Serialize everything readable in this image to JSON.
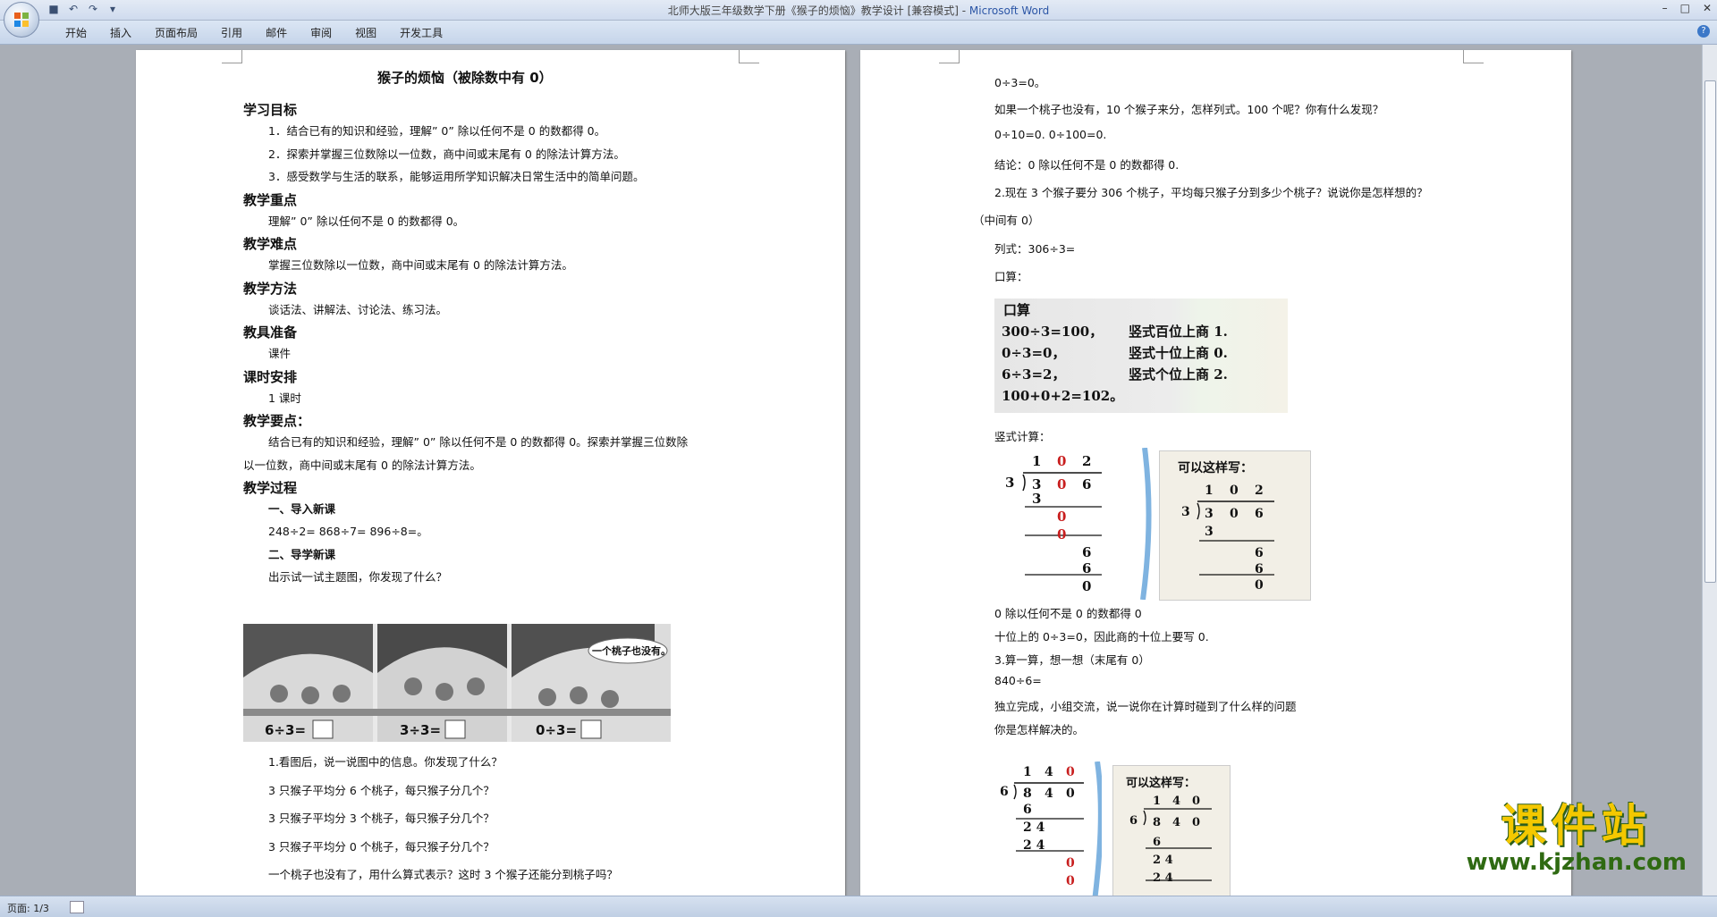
{
  "window": {
    "title": "北师大版三年级数学下册《猴子的烦恼》教学设计 [兼容模式] - ",
    "app_name": "Microsoft Word"
  },
  "ribbon": {
    "tabs": [
      "开始",
      "插入",
      "页面布局",
      "引用",
      "邮件",
      "审阅",
      "视图",
      "开发工具"
    ]
  },
  "status": {
    "page": "页面: 1/3"
  },
  "watermark": {
    "text": "课件站",
    "url": "www.kjzhan.com"
  },
  "page1": {
    "title": "猴子的烦恼（被除数中有 0）",
    "sections": [
      {
        "heading": "学习目标"
      },
      {
        "line": "1．结合已有的知识和经验，理解” 0” 除以任何不是 0 的数都得 0。"
      },
      {
        "line": "2．探索并掌握三位数除以一位数，商中间或末尾有 0 的除法计算方法。"
      },
      {
        "line": "3．感受数学与生活的联系，能够运用所学知识解决日常生活中的简单问题。"
      },
      {
        "heading": "教学重点"
      },
      {
        "line": "理解” 0” 除以任何不是 0 的数都得 0。"
      },
      {
        "heading": "教学难点"
      },
      {
        "line": "掌握三位数除以一位数，商中间或末尾有 0 的除法计算方法。"
      },
      {
        "heading": "教学方法"
      },
      {
        "line": "谈话法、讲解法、讨论法、练习法。"
      },
      {
        "heading": "教具准备"
      },
      {
        "line": "课件"
      },
      {
        "heading": "课时安排"
      },
      {
        "line": "1 课时"
      },
      {
        "heading": "教学要点："
      },
      {
        "line": "结合已有的知识和经验，理解” 0” 除以任何不是 0 的数都得 0。探索并掌握三位数除"
      },
      {
        "line": "以一位数，商中间或末尾有 0 的除法计算方法。"
      },
      {
        "heading": "教学过程"
      },
      {
        "subheading": "一、导入新课"
      },
      {
        "line": "248÷2=          868÷7=               896÷8=。"
      },
      {
        "subheading": "二、导学新课"
      },
      {
        "line": "出示试一试主题图，你发现了什么？"
      }
    ],
    "image_captions": [
      "6÷3=",
      "3÷3=",
      "0÷3=",
      "一个桃子也没有。"
    ],
    "after_image": [
      "1.看图后，说一说图中的信息。你发现了什么？",
      "3 只猴子平均分 6 个桃子，每只猴子分几个？",
      "3 只猴子平均分 3 个桃子，每只猴子分几个？",
      "3 只猴子平均分 0 个桃子，每只猴子分几个？",
      "一个桃子也没有了，用什么算式表示？这时 3 个猴子还能分到桃子吗？"
    ]
  },
  "page2": {
    "lines": [
      "0÷3=0。",
      "如果一个桃子也没有，10 个猴子来分，怎样列式。100 个呢？你有什么发现？",
      "0÷10=0.       0÷100=0.",
      "结论：0 除以任何不是 0 的数都得 0.",
      "2.现在 3 个猴子要分 306 个桃子，平均每只猴子分到多少个桃子？说说你是怎样想的？",
      "（中间有 0）",
      "列式：306÷3=",
      "口算："
    ],
    "oral": {
      "title": "口算",
      "rows": [
        [
          "300÷3=100，",
          "竖式百位上商 1."
        ],
        [
          "0÷3=0，",
          "竖式十位上商 0."
        ],
        [
          "6÷3=2，",
          "竖式个位上商 2."
        ],
        [
          "100+0+2=102。",
          ""
        ]
      ]
    },
    "vertical_label": "竖式计算：",
    "div1": {
      "divisor": "3",
      "quotient": [
        "1",
        "0",
        "2"
      ],
      "dividend": [
        "3",
        "0",
        "6"
      ],
      "steps": [
        "3",
        "0",
        "0",
        "6",
        "6",
        "0"
      ]
    },
    "alt_label": "可以这样写：",
    "div1b": {
      "divisor": "3",
      "quotient": [
        "1",
        "0",
        "2"
      ],
      "dividend": [
        "3",
        "0",
        "6"
      ],
      "steps": [
        "3",
        "6",
        "6",
        "0"
      ]
    },
    "lines2": [
      "0 除以任何不是 0 的数都得 0",
      "十位上的 0÷3=0，因此商的十位上要写 0.",
      "3.算一算，想一想（末尾有 0）",
      "840÷6=",
      "独立完成，小组交流，说一说你在计算时碰到了什么样的问题",
      "你是怎样解决的。"
    ],
    "div2": {
      "divisor": "6",
      "quotient": [
        "1",
        "4",
        "0"
      ],
      "dividend": [
        "8",
        "4",
        "0"
      ],
      "steps": [
        "6",
        "2 4",
        "2 4",
        "0",
        "0"
      ]
    },
    "div2b": {
      "divisor": "6",
      "quotient": [
        "1",
        "4",
        "0"
      ],
      "dividend": [
        "8",
        "4",
        "0"
      ],
      "steps": [
        "6",
        "2 4",
        "2 4"
      ]
    }
  }
}
